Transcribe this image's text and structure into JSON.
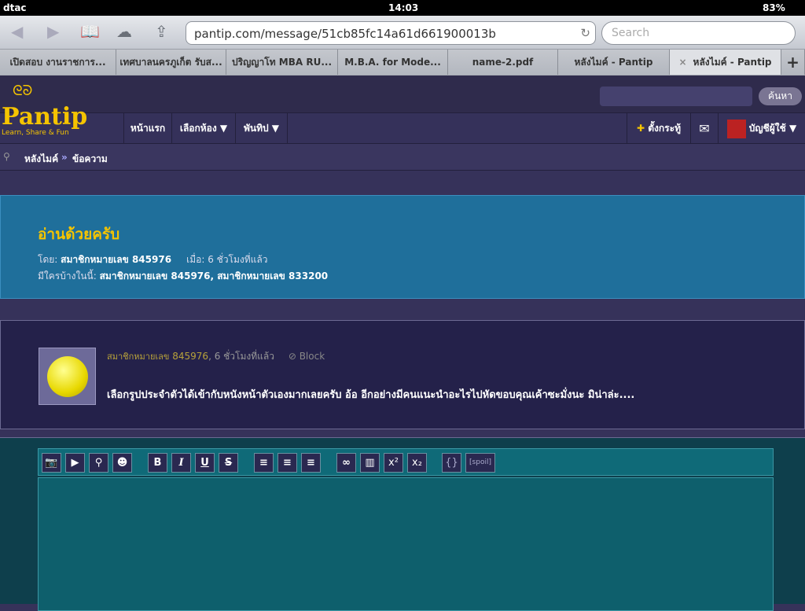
{
  "status": {
    "carrier": "dtac",
    "time": "14:03",
    "battery": "83%"
  },
  "browser": {
    "url": "pantip.com/message/51cb85fc14a61d661900013b",
    "search_placeholder": "Search",
    "tabs": [
      "เปิดสอบ งานราชการ...",
      "เทศบาลนครภูเก็ต รับส...",
      "ปริญญาโท MBA RU...",
      "M.B.A. for Mode...",
      "name-2.pdf",
      "หลังไมค์ - Pantip",
      "หลังไมค์ - Pantip"
    ],
    "new_tab": "+",
    "close": "×"
  },
  "site": {
    "logo": "Pantip",
    "tagline": "Learn, Share & Fun",
    "search_button": "ค้นหา",
    "nav": [
      "หน้าแรก",
      "เลือกห้อง ▼",
      "พันทิป ▼"
    ],
    "new_topic": "ตั้งกระทู้",
    "account": "บัญชีผู้ใช้ ▼"
  },
  "breadcrumb": {
    "items": [
      "หลังไมค์",
      "ข้อความ"
    ],
    "sep": "»"
  },
  "topic": {
    "title": "อ่านด้วยครับ",
    "by_label": "โดย:",
    "by": "สมาชิกหมายเลข 845976",
    "when_label": "เมื่อ:",
    "when": "6 ชั่วโมงที่แล้ว",
    "members_label": "มีใครบ้างในนี้:",
    "members": "สมาชิกหมายเลข 845976, สมาชิกหมายเลข 833200"
  },
  "post": {
    "author": "สมาชิกหมายเลข",
    "author_id": "845976",
    "time": ", 6 ชั่วโมงที่แล้ว",
    "block": "Block",
    "body": "เลือกรูปประจำตัวได้เข้ากับหนังหน้าตัวเองมากเลยครับ อ้อ อีกอย่างมีคนแนะนำอะไรไปหัดขอบคุณเค้าซะมั่งนะ มิน่าล่ะ...."
  },
  "editor": {
    "buttons": [
      "📷",
      "▶",
      "⚲",
      "☻",
      "B",
      "I",
      "U",
      "S",
      "≡",
      "≡",
      "≡",
      "∞",
      "▥",
      "x²",
      "x₂",
      "{}",
      "[spoil]"
    ]
  }
}
